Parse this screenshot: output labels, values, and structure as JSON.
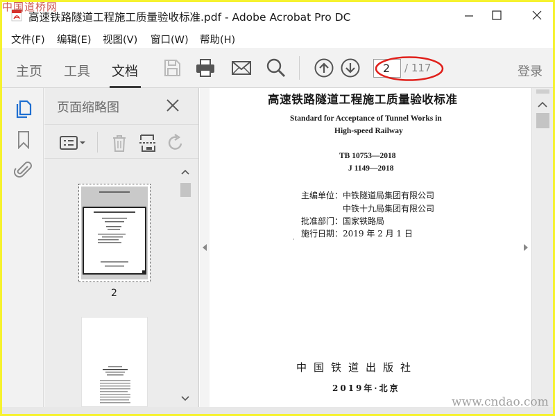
{
  "window": {
    "title": "高速铁路隧道工程施工质量验收标准.pdf - Adobe Acrobat Pro DC",
    "watermark_top_left": "中国道桥网",
    "watermark_bottom_right": "www.cndao.com"
  },
  "menu": [
    "文件(F)",
    "编辑(E)",
    "视图(V)",
    "窗口(W)",
    "帮助(H)"
  ],
  "toolbar": {
    "tabs": [
      "主页",
      "工具",
      "文档"
    ],
    "active_tab": "文档",
    "tool_icons": [
      "save-icon",
      "print-icon",
      "email-icon",
      "search-icon",
      "prev-page-icon",
      "next-page-icon"
    ],
    "current_page": "2",
    "page_total": "/ 117",
    "login": "登录",
    "highlight_color": "#e0201b"
  },
  "left_rail": {
    "icons": [
      "page-thumbnails-icon",
      "bookmark-icon",
      "attachment-icon"
    ],
    "active_color": "#1f6fd1"
  },
  "thumbnail_panel": {
    "title": "页面缩略图",
    "tools": [
      "thumbnail-options-icon",
      "delete-page-icon",
      "extract-page-icon",
      "rotate-page-icon"
    ],
    "thumbnails": [
      {
        "page_label": "2",
        "selected": true
      },
      {
        "page_label": "",
        "selected": false
      }
    ]
  },
  "document": {
    "title_cn": "高速铁路隧道工程施工质量验收标准",
    "title_en_line1": "Standard for Acceptance of Tunnel Works in",
    "title_en_line2": "High-speed Railway",
    "code1": "TB 10753—2018",
    "code2": "J 1149—2018",
    "editor_label_line1": "主编单位：中铁隧道局集团有限公司",
    "editor_line2": "中铁十九局集团有限公司",
    "approver": "批准部门：国家铁路局",
    "effective_date": "施行日期：2019 年 2 月 1 日",
    "publisher": "中国铁道出版社",
    "pub_year_place": "2019年·北京"
  }
}
